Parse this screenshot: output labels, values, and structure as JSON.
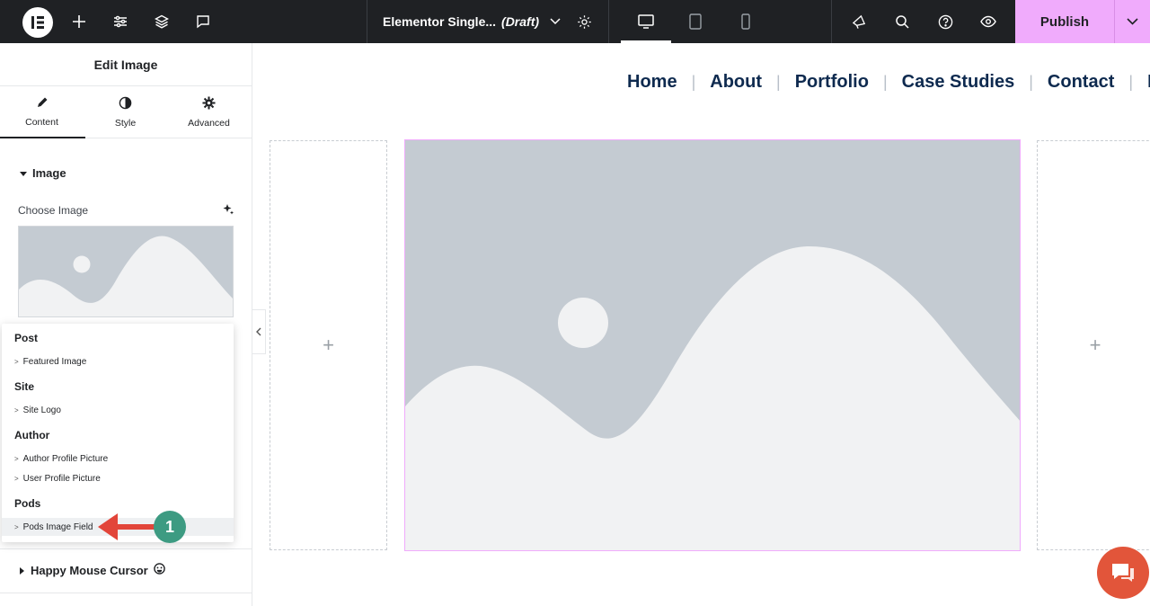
{
  "topbar": {
    "doc_title": "Elementor Single...",
    "doc_status": "(Draft)",
    "publish_label": "Publish"
  },
  "panel": {
    "title": "Edit Image",
    "tabs": [
      {
        "label": "Content",
        "icon": "pencil-icon"
      },
      {
        "label": "Style",
        "icon": "half-circle-icon"
      },
      {
        "label": "Advanced",
        "icon": "gear-icon"
      }
    ],
    "section_title": "Image",
    "choose_label": "Choose Image",
    "happy_cursor_label": "Happy Mouse Cursor"
  },
  "dropdown": {
    "groups": [
      {
        "name": "Post",
        "items": [
          "Featured Image"
        ]
      },
      {
        "name": "Site",
        "items": [
          "Site Logo"
        ]
      },
      {
        "name": "Author",
        "items": [
          "Author Profile Picture",
          "User Profile Picture"
        ]
      },
      {
        "name": "Pods",
        "items": [
          "Pods Image Field"
        ]
      }
    ]
  },
  "annotation": {
    "step": "1"
  },
  "nav": {
    "items": [
      "Home",
      "About",
      "Portfolio",
      "Case Studies",
      "Contact",
      "Bl"
    ]
  },
  "canvas": {
    "add_symbol": "+"
  },
  "colors": {
    "topbar_bg": "#1f2124",
    "publish_bg": "#f0abfc",
    "nav_text": "#0e2a4f",
    "badge": "#3d9b82",
    "arrow": "#e2453a",
    "chat": "#e2553a"
  }
}
